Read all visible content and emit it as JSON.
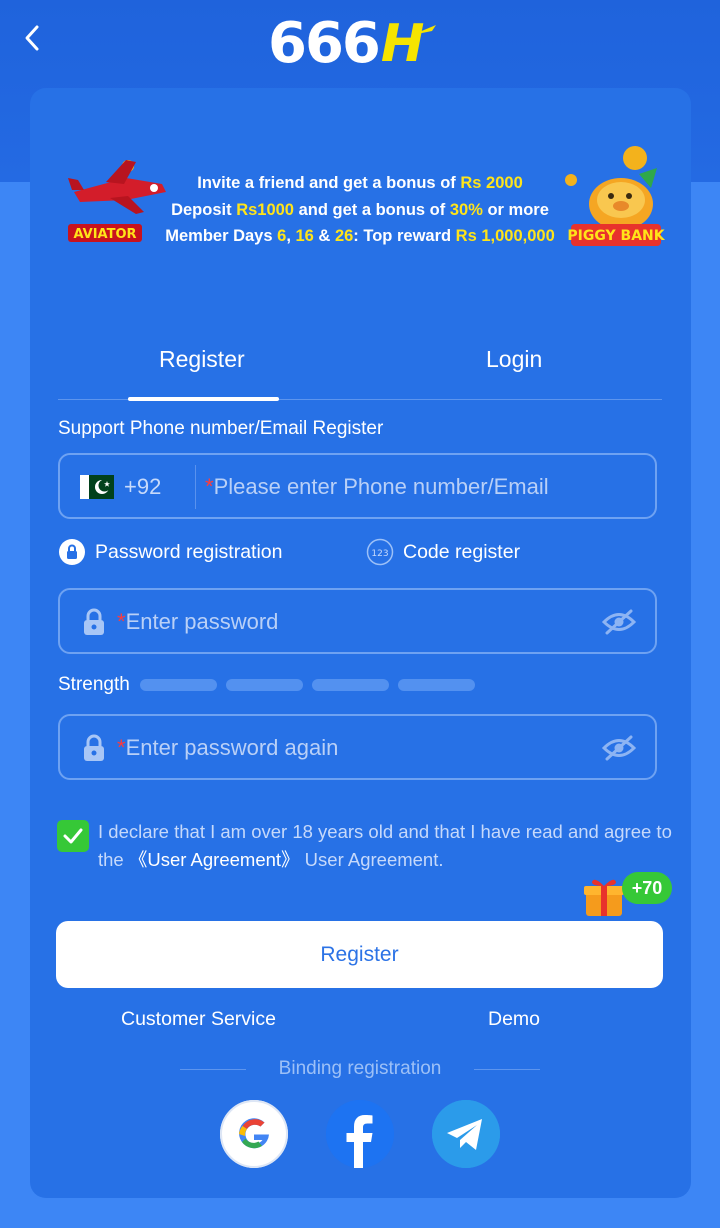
{
  "header": {
    "logo_number": "666",
    "logo_letter": "H"
  },
  "banner": {
    "aviator_label": "AVIATOR",
    "piggy_label": "PIGGY BANK",
    "line1": {
      "prefix": "Invite a friend and get a bonus of ",
      "amount": "Rs 2000"
    },
    "line2": {
      "prefix": "Deposit ",
      "amount": "Rs1000",
      "middle": " and get a bonus of ",
      "percent": "30%",
      "suffix": " or more"
    },
    "line3": {
      "prefix": "Member Days ",
      "d1": "6",
      "sep1": ", ",
      "d2": "16",
      "sep2": " & ",
      "d3": "26",
      "middle": ": Top reward ",
      "amount": "Rs 1,000,000"
    }
  },
  "tabs": {
    "register": "Register",
    "login": "Login"
  },
  "form": {
    "section_label": "Support Phone number/Email Register",
    "country_code": "+92",
    "phone_placeholder": "Please enter Phone number/Email",
    "required_mark": "*",
    "mode_password": "Password registration",
    "mode_code": "Code register",
    "password_placeholder": "Enter password",
    "strength_label": "Strength",
    "password_again_placeholder": "Enter password again"
  },
  "agreement": {
    "text_before": "I declare that I am over 18 years old and that I have read and agree to the ",
    "link": "《User Agreement》",
    "text_after": " User Agreement.",
    "checked": true
  },
  "bonus_badge": "+70",
  "register_button": "Register",
  "links": {
    "customer_service": "Customer Service",
    "demo": "Demo"
  },
  "binding_label": "Binding registration",
  "social_icons": [
    "google-icon",
    "facebook-icon",
    "telegram-icon"
  ],
  "colors": {
    "accent_yellow": "#ffe419",
    "card_blue": "#2771e6",
    "check_green": "#36c837",
    "required_red": "#ff3b3b"
  }
}
